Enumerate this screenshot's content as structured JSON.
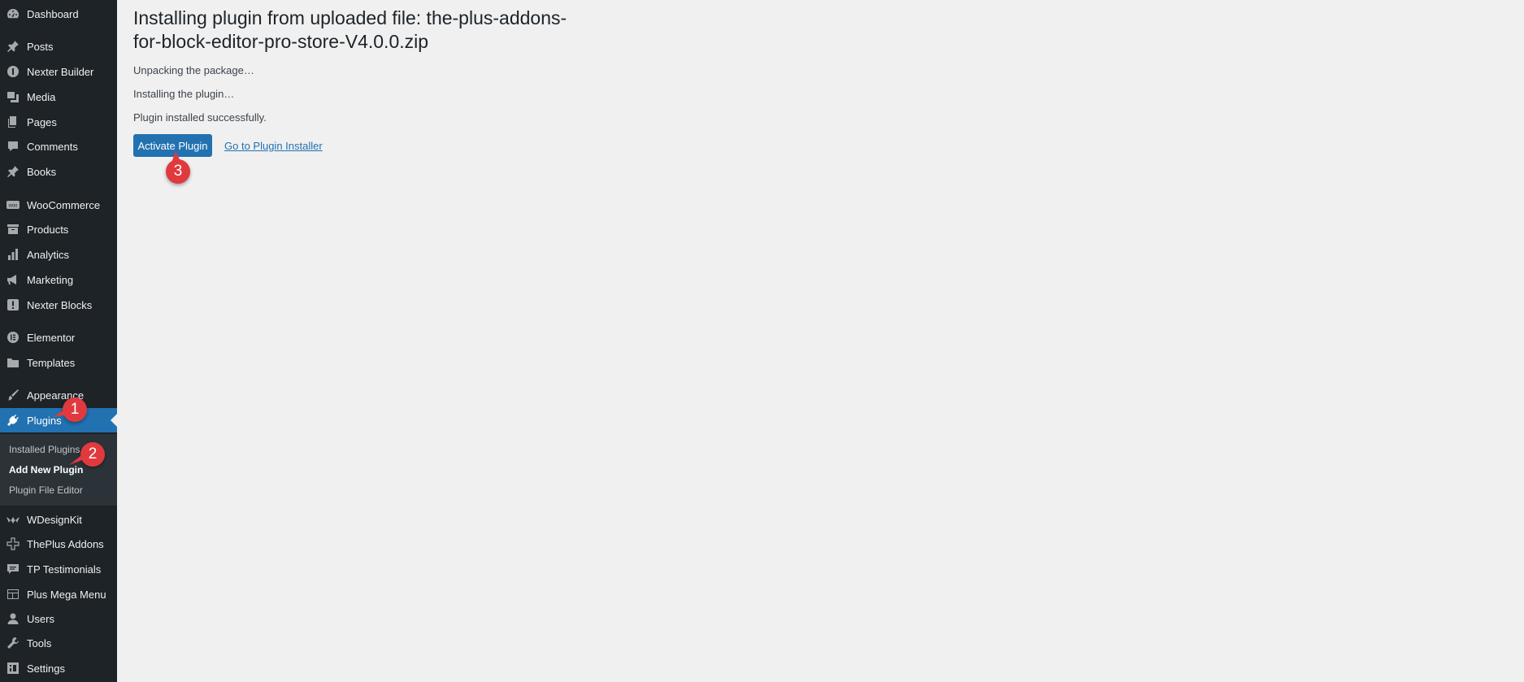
{
  "sidebar": {
    "items": [
      {
        "label": "Dashboard",
        "icon": "dashboard-icon"
      },
      {
        "label": "Posts",
        "icon": "pin-icon"
      },
      {
        "label": "Nexter Builder",
        "icon": "nexter-builder-icon"
      },
      {
        "label": "Media",
        "icon": "media-icon"
      },
      {
        "label": "Pages",
        "icon": "pages-icon"
      },
      {
        "label": "Comments",
        "icon": "comment-icon"
      },
      {
        "label": "Books",
        "icon": "pin-icon"
      },
      {
        "label": "WooCommerce",
        "icon": "woo-icon"
      },
      {
        "label": "Products",
        "icon": "archive-icon"
      },
      {
        "label": "Analytics",
        "icon": "bar-chart-icon"
      },
      {
        "label": "Marketing",
        "icon": "megaphone-icon"
      },
      {
        "label": "Nexter Blocks",
        "icon": "nexter-blocks-icon"
      },
      {
        "label": "Elementor",
        "icon": "elementor-icon"
      },
      {
        "label": "Templates",
        "icon": "folder-icon"
      },
      {
        "label": "Appearance",
        "icon": "paintbrush-icon"
      },
      {
        "label": "Plugins",
        "icon": "plugin-icon"
      },
      {
        "label": "WDesignKit",
        "icon": "wdesignkit-icon"
      },
      {
        "label": "ThePlus Addons",
        "icon": "theplus-icon"
      },
      {
        "label": "TP Testimonials",
        "icon": "testimonial-icon"
      },
      {
        "label": "Plus Mega Menu",
        "icon": "mega-menu-icon"
      },
      {
        "label": "Users",
        "icon": "user-icon"
      },
      {
        "label": "Tools",
        "icon": "wrench-icon"
      },
      {
        "label": "Settings",
        "icon": "settings-icon"
      }
    ],
    "submenu": {
      "installed": "Installed Plugins",
      "add_new": "Add New Plugin",
      "file_editor": "Plugin File Editor"
    }
  },
  "main": {
    "title": "Installing plugin from uploaded file: the-plus-addons-for-block-editor-pro-store-V4.0.0.zip",
    "status_lines": [
      "Unpacking the package…",
      "Installing the plugin…",
      "Plugin installed successfully."
    ],
    "activate_button": "Activate Plugin",
    "installer_link": "Go to Plugin Installer"
  },
  "annotations": [
    "1",
    "2",
    "3"
  ],
  "colors": {
    "sidebar_bg": "#1d2327",
    "accent": "#2271b1",
    "page_bg": "#f0f0f1",
    "badge": "#e03a3e"
  }
}
